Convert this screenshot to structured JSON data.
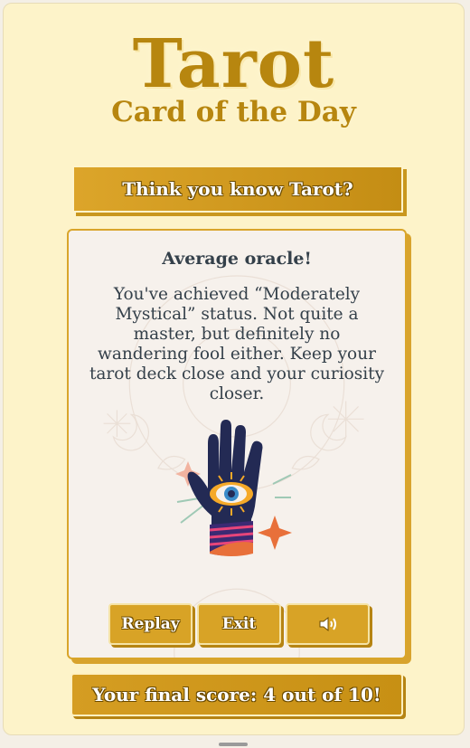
{
  "header": {
    "title": "Tarot",
    "subtitle": "Card of the Day"
  },
  "banner": {
    "text": "Think you know Tarot?"
  },
  "result": {
    "heading": "Average oracle!",
    "message": "You've achieved “Moderately Mystical” status. Not quite a master, but definitely no wandering fool either. Keep your tarot deck close and your curiosity closer.",
    "illustration": "palm-eye-hand-icon"
  },
  "buttons": {
    "replay": "Replay",
    "exit": "Exit",
    "sound_icon": "speaker-icon"
  },
  "score": {
    "text": "Your final score: 4 out of 10!"
  },
  "colors": {
    "background": "#fdf3c9",
    "accent": "#d8a326",
    "text": "#34404a",
    "card": "#f6f1ec"
  }
}
